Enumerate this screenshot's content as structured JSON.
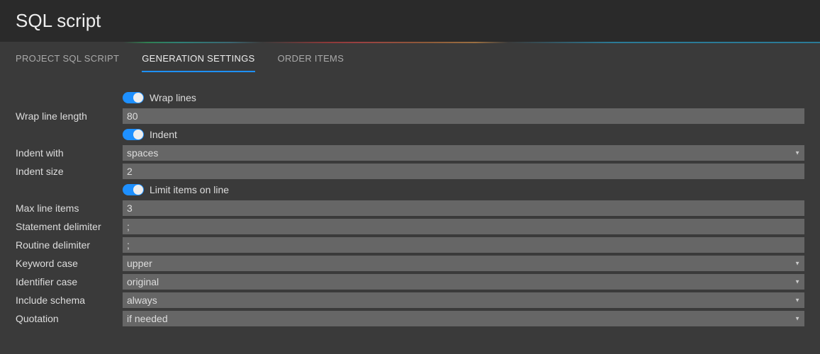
{
  "header": {
    "title": "SQL script"
  },
  "tabs": {
    "items": [
      {
        "label": "PROJECT SQL SCRIPT",
        "active": false
      },
      {
        "label": "GENERATION SETTINGS",
        "active": true
      },
      {
        "label": "ORDER ITEMS",
        "active": false
      }
    ]
  },
  "form": {
    "wrapLines": {
      "label": "Wrap lines",
      "checked": true
    },
    "wrapLineLength": {
      "label": "Wrap line length",
      "value": "80"
    },
    "indent": {
      "label": "Indent",
      "checked": true
    },
    "indentWith": {
      "label": "Indent with",
      "value": "spaces"
    },
    "indentSize": {
      "label": "Indent size",
      "value": "2"
    },
    "limitItems": {
      "label": "Limit items on line",
      "checked": true
    },
    "maxLineItems": {
      "label": "Max line items",
      "value": "3"
    },
    "statementDelimiter": {
      "label": "Statement delimiter",
      "value": ";"
    },
    "routineDelimiter": {
      "label": "Routine delimiter",
      "value": ";"
    },
    "keywordCase": {
      "label": "Keyword case",
      "value": "upper"
    },
    "identifierCase": {
      "label": "Identifier case",
      "value": "original"
    },
    "includeSchema": {
      "label": "Include schema",
      "value": "always"
    },
    "quotation": {
      "label": "Quotation",
      "value": "if needed"
    }
  }
}
